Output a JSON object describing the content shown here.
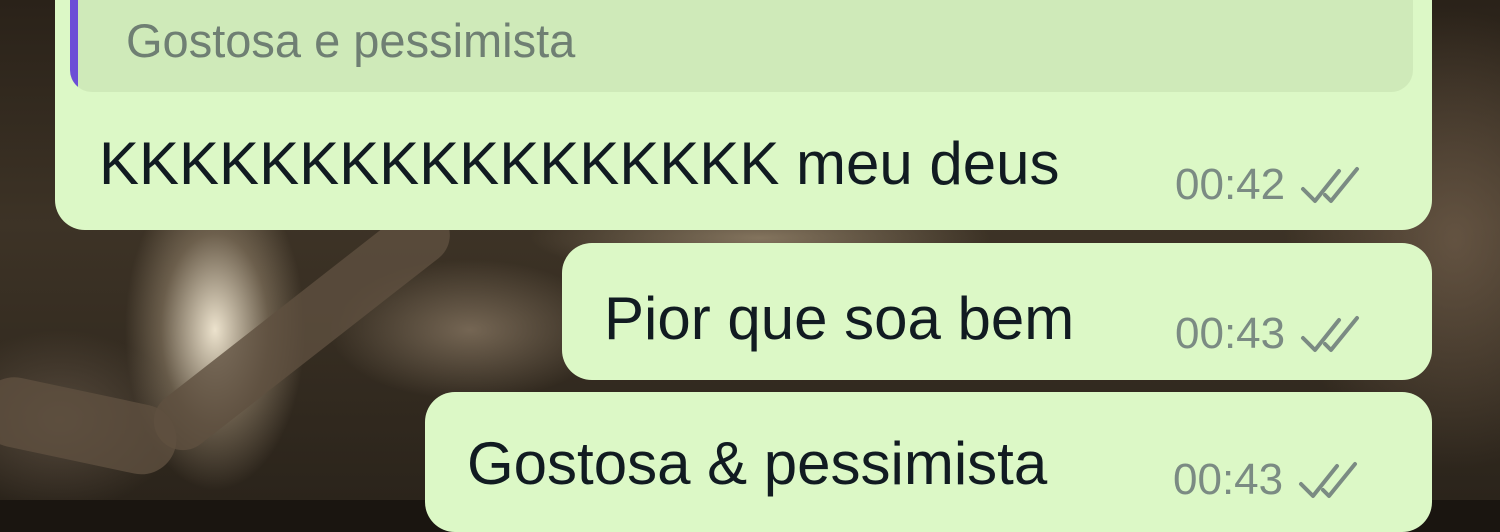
{
  "reply_quote": {
    "text": "Gostosa e pessimista"
  },
  "messages": [
    {
      "text": "KKKKKKKKKKKKKKKKK meu deus",
      "time": "00:42",
      "status_icon": "double-check-icon"
    },
    {
      "text": "Pior que soa bem",
      "time": "00:43",
      "status_icon": "double-check-icon"
    },
    {
      "text": "Gostosa & pessimista",
      "time": "00:43",
      "status_icon": "double-check-icon"
    }
  ],
  "colors": {
    "bubble": "#dcf8c6",
    "quote_background": "#cfeab9",
    "quote_bar": "#6c4fd6",
    "message_text": "#111b21",
    "meta_text": "#7b8b83"
  }
}
